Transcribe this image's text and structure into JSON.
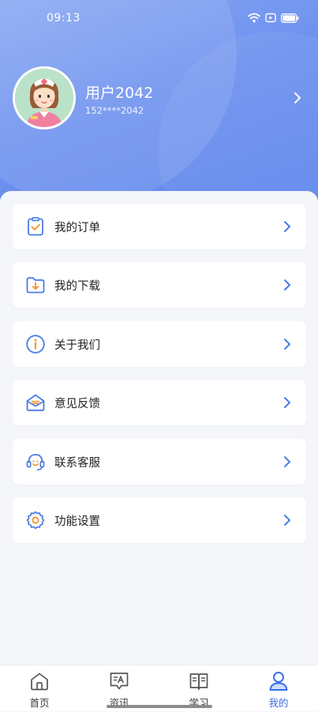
{
  "status_bar": {
    "time": "09:13",
    "icons": [
      "wifi-icon",
      "screen-record-icon",
      "battery-icon"
    ]
  },
  "profile": {
    "username": "用户2042",
    "phone": "152****2042"
  },
  "menu": {
    "items": [
      {
        "label": "我的订单",
        "icon": "order-clipboard-icon"
      },
      {
        "label": "我的下载",
        "icon": "download-folder-icon"
      },
      {
        "label": "关于我们",
        "icon": "info-icon"
      },
      {
        "label": "意见反馈",
        "icon": "feedback-envelope-icon"
      },
      {
        "label": "联系客服",
        "icon": "customer-service-headset-icon"
      },
      {
        "label": "功能设置",
        "icon": "settings-gear-icon"
      }
    ]
  },
  "tabbar": {
    "tabs": [
      {
        "label": "首页",
        "icon": "home-icon"
      },
      {
        "label": "资讯",
        "icon": "news-icon"
      },
      {
        "label": "学习",
        "icon": "study-book-icon"
      },
      {
        "label": "我的",
        "icon": "profile-user-icon"
      }
    ],
    "active_index": 3
  },
  "colors": {
    "header_gradient": [
      "#8aa9f3",
      "#5f86ec"
    ],
    "accent": "#3b6fe6",
    "icon_orange": "#f29b38",
    "page_bg": "#f4f6fa"
  }
}
